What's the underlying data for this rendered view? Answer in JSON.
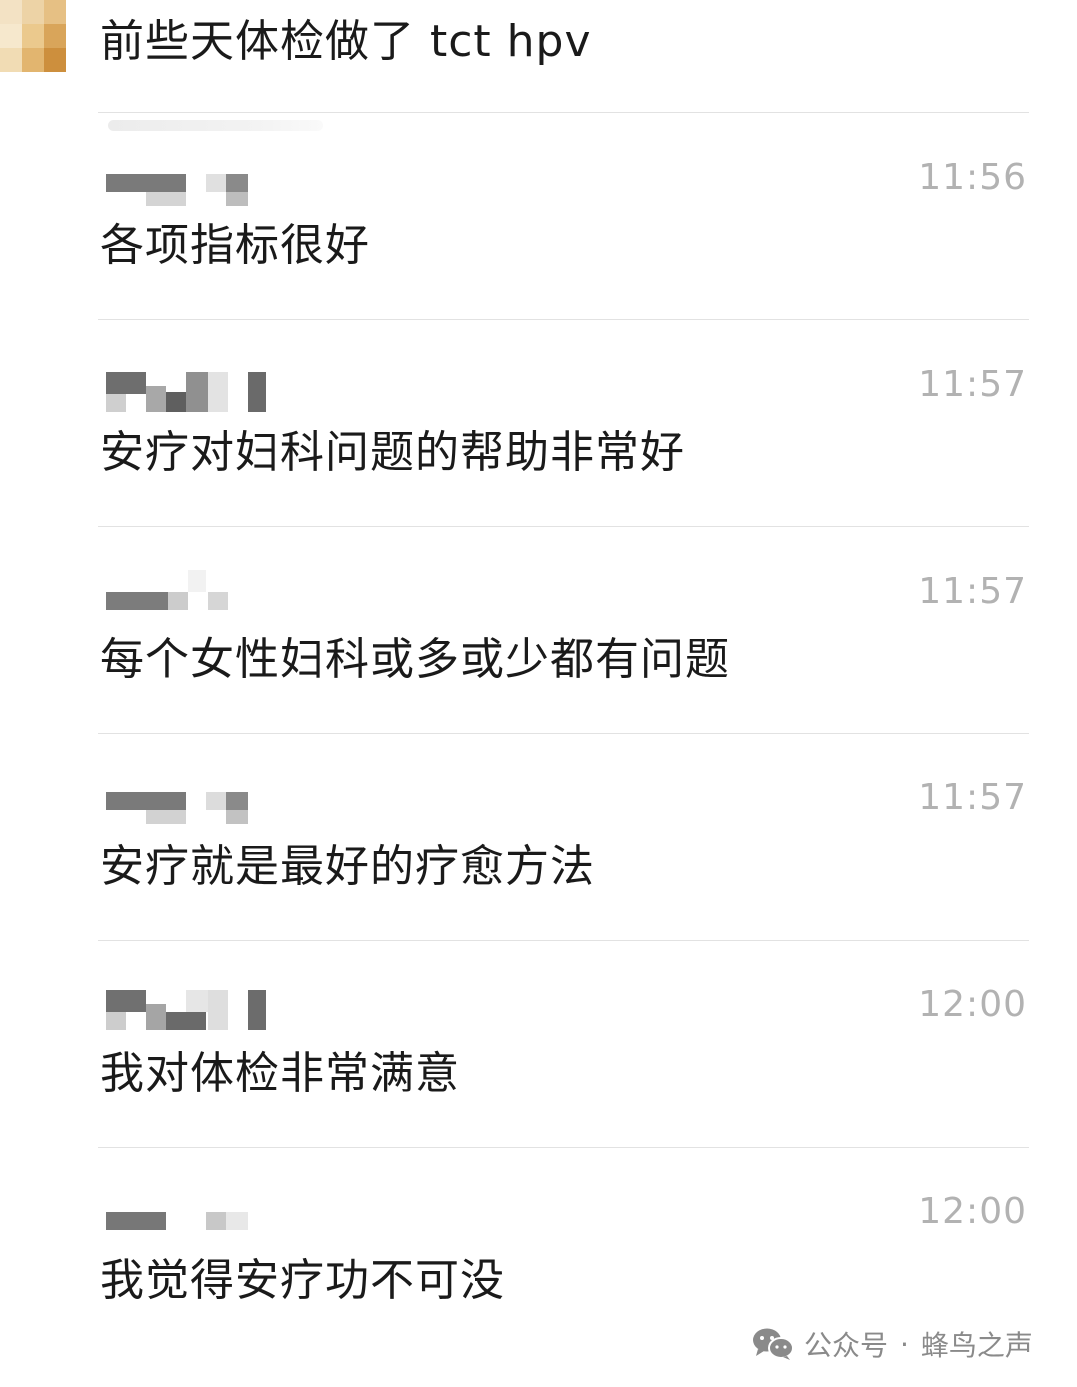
{
  "messages": [
    {
      "text": "前些天体检做了 tct hpv",
      "time": ""
    },
    {
      "text": "各项指标很好",
      "time": "11:56"
    },
    {
      "text": "安疗对妇科问题的帮助非常好",
      "time": "11:57"
    },
    {
      "text": "每个女性妇科或多或少都有问题",
      "time": "11:57"
    },
    {
      "text": "安疗就是最好的疗愈方法",
      "time": "11:57"
    },
    {
      "text": "我对体检非常满意",
      "time": "12:00"
    },
    {
      "text": "我觉得安疗功不可没",
      "time": "12:00"
    }
  ],
  "watermark": {
    "platform": "公众号",
    "separator": "·",
    "account": "蜂鸟之声",
    "icon": "wechat-icon"
  },
  "colors": {
    "time": "#b2b2b2",
    "divider": "#e2e2e2",
    "blur_dark": "#6e6e6e",
    "blur_light": "#d9d9d9"
  }
}
